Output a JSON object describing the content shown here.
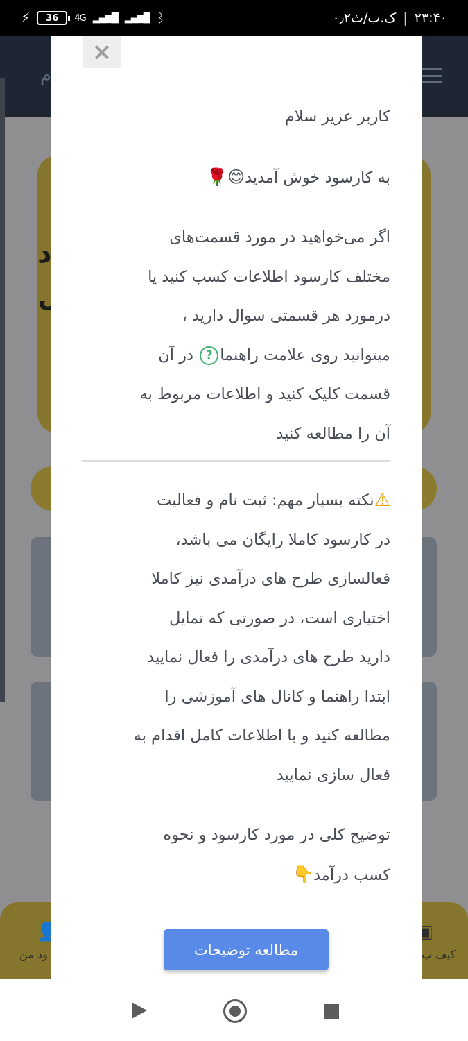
{
  "status_bar": {
    "battery": "36",
    "network": "4G",
    "clock": "۲۳:۴۰",
    "data_speed": "۰٫۲ک.ب/ث"
  },
  "background": {
    "header_text": "م",
    "card_line1": "د",
    "card_line2": "ل",
    "nav_left_label": "ود من",
    "nav_right_label": "کیف پ"
  },
  "modal": {
    "close_label": "×",
    "greeting": "کاربر عزیز سلام",
    "welcome": "به کارسود خوش آمدید",
    "welcome_emojis": "😊🌹",
    "guide_line1": "اگر می‌خواهید در مورد قسمت‌های",
    "guide_line2": "مختلف کارسود اطلاعات کسب کنید یا",
    "guide_line3": "درمورد هر قسمتی سوال دارید ،",
    "guide_line4_a": "میتوانید روی علامت راهنما",
    "guide_line4_icon": "?",
    "guide_line4_b": "در آن",
    "guide_line5": "قسمت کلیک کنید و اطلاعات مربوط به",
    "guide_line6": "آن را مطالعه کنید",
    "note_icon": "⚠",
    "note_line1": "نکته بسیار مهم: ثبت نام و فعالیت",
    "note_line2": "در کارسود کاملا رایگان می باشد،",
    "note_line3": "فعالسازی طرح های درآمدی نیز کاملا",
    "note_line4": "اختیاری است، در صورتی که تمایل",
    "note_line5": "دارید طرح های درآمدی را فعال نمایید",
    "note_line6": "ابتدا راهنما و کانال های آموزشی را",
    "note_line7": "مطالعه کنید و با اطلاعات کامل اقدام به",
    "note_line8": "فعال سازی نمایید",
    "summary_line1": "توضیح کلی در مورد کارسود و نحوه",
    "summary_line2": "کسب درآمد",
    "summary_emoji": "👇",
    "read_button": "مطالعه توضیحات"
  },
  "colors": {
    "button": "#5a8ae7",
    "help_icon": "#3cb371",
    "warning": "#e8a315",
    "text": "#494d55"
  }
}
